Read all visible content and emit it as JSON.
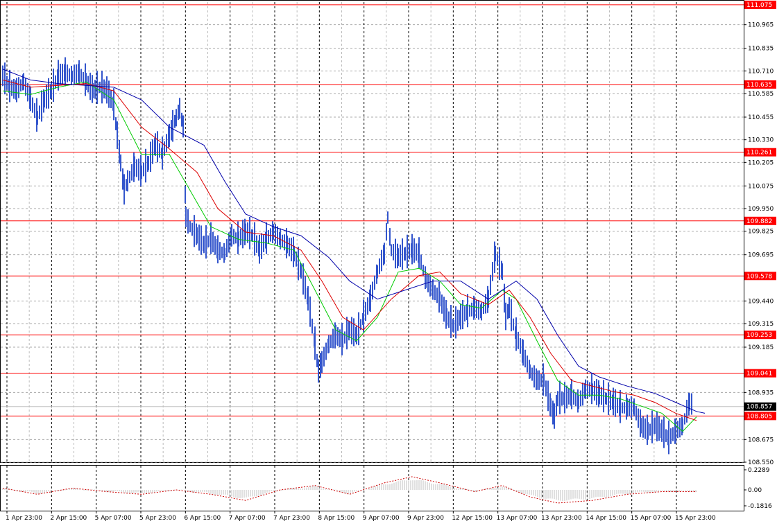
{
  "chart_data": {
    "type": "candlestick",
    "title": "",
    "xlabel": "",
    "ylabel": "",
    "ylim": [
      108.55,
      111.09
    ],
    "grid": true,
    "price_ticks": [
      "110.965",
      "110.835",
      "110.710",
      "110.585",
      "110.455",
      "110.330",
      "110.205",
      "110.075",
      "109.950",
      "109.825",
      "109.695",
      "109.440",
      "109.315",
      "109.185",
      "108.935",
      "108.675",
      "108.550"
    ],
    "x_labels": [
      "1 Apr 23:00",
      "2 Apr 15:00",
      "5 Apr 07:00",
      "5 Apr 23:00",
      "6 Apr 15:00",
      "7 Apr 07:00",
      "7 Apr 23:00",
      "8 Apr 15:00",
      "9 Apr 07:00",
      "9 Apr 23:00",
      "12 Apr 15:00",
      "13 Apr 07:00",
      "13 Apr 23:00",
      "14 Apr 15:00",
      "15 Apr 07:00",
      "15 Apr 23:00"
    ],
    "levels": [
      {
        "label": "111.075",
        "value": 111.075
      },
      {
        "label": "110.635",
        "value": 110.635
      },
      {
        "label": "110.261",
        "value": 110.261
      },
      {
        "label": "109.882",
        "value": 109.882
      },
      {
        "label": "109.578",
        "value": 109.578
      },
      {
        "label": "109.253",
        "value": 109.253
      },
      {
        "label": "109.041",
        "value": 109.041
      },
      {
        "label": "108.805",
        "value": 108.805
      }
    ],
    "current_price": {
      "label": "108.857",
      "value": 108.857
    },
    "path_points": [
      [
        0,
        110.68
      ],
      [
        10,
        110.62
      ],
      [
        20,
        110.6
      ],
      [
        30,
        110.65
      ],
      [
        40,
        110.55
      ],
      [
        50,
        110.45
      ],
      [
        60,
        110.55
      ],
      [
        70,
        110.6
      ],
      [
        80,
        110.68
      ],
      [
        90,
        110.7
      ],
      [
        100,
        110.68
      ],
      [
        110,
        110.7
      ],
      [
        120,
        110.65
      ],
      [
        130,
        110.6
      ],
      [
        140,
        110.62
      ],
      [
        150,
        110.6
      ],
      [
        160,
        110.52
      ],
      [
        165,
        110.35
      ],
      [
        170,
        110.2
      ],
      [
        175,
        110.05
      ],
      [
        180,
        110.1
      ],
      [
        190,
        110.18
      ],
      [
        200,
        110.15
      ],
      [
        210,
        110.2
      ],
      [
        220,
        110.3
      ],
      [
        230,
        110.25
      ],
      [
        240,
        110.35
      ],
      [
        245,
        110.4
      ],
      [
        250,
        110.45
      ],
      [
        255,
        110.5
      ],
      [
        260,
        110.4
      ],
      [
        264,
        109.9
      ],
      [
        270,
        109.85
      ],
      [
        280,
        109.8
      ],
      [
        290,
        109.75
      ],
      [
        300,
        109.78
      ],
      [
        310,
        109.72
      ],
      [
        320,
        109.7
      ],
      [
        330,
        109.8
      ],
      [
        340,
        109.78
      ],
      [
        350,
        109.82
      ],
      [
        360,
        109.8
      ],
      [
        370,
        109.72
      ],
      [
        380,
        109.78
      ],
      [
        390,
        109.82
      ],
      [
        400,
        109.78
      ],
      [
        410,
        109.75
      ],
      [
        420,
        109.7
      ],
      [
        430,
        109.6
      ],
      [
        440,
        109.45
      ],
      [
        450,
        109.2
      ],
      [
        455,
        109.05
      ],
      [
        460,
        109.1
      ],
      [
        470,
        109.2
      ],
      [
        480,
        109.25
      ],
      [
        490,
        109.22
      ],
      [
        500,
        109.28
      ],
      [
        510,
        109.25
      ],
      [
        520,
        109.35
      ],
      [
        530,
        109.45
      ],
      [
        540,
        109.6
      ],
      [
        550,
        109.7
      ],
      [
        555,
        109.9
      ],
      [
        560,
        109.72
      ],
      [
        570,
        109.68
      ],
      [
        580,
        109.7
      ],
      [
        590,
        109.72
      ],
      [
        600,
        109.7
      ],
      [
        610,
        109.55
      ],
      [
        620,
        109.5
      ],
      [
        630,
        109.45
      ],
      [
        640,
        109.35
      ],
      [
        650,
        109.3
      ],
      [
        660,
        109.35
      ],
      [
        670,
        109.38
      ],
      [
        680,
        109.4
      ],
      [
        690,
        109.38
      ],
      [
        700,
        109.45
      ],
      [
        710,
        109.7
      ],
      [
        720,
        109.6
      ],
      [
        725,
        109.35
      ],
      [
        730,
        109.4
      ],
      [
        740,
        109.25
      ],
      [
        750,
        109.15
      ],
      [
        760,
        109.05
      ],
      [
        770,
        109.0
      ],
      [
        780,
        109.0
      ],
      [
        790,
        108.85
      ],
      [
        795,
        108.8
      ],
      [
        800,
        108.9
      ],
      [
        810,
        108.9
      ],
      [
        820,
        108.92
      ],
      [
        830,
        108.88
      ],
      [
        840,
        108.95
      ],
      [
        850,
        108.95
      ],
      [
        860,
        108.92
      ],
      [
        870,
        108.9
      ],
      [
        880,
        108.88
      ],
      [
        890,
        108.85
      ],
      [
        900,
        108.85
      ],
      [
        910,
        108.85
      ],
      [
        920,
        108.75
      ],
      [
        930,
        108.72
      ],
      [
        940,
        108.75
      ],
      [
        950,
        108.72
      ],
      [
        960,
        108.68
      ],
      [
        970,
        108.72
      ],
      [
        980,
        108.75
      ],
      [
        990,
        108.88
      ],
      [
        995,
        108.86
      ]
    ],
    "ma_green": [
      [
        0,
        110.6
      ],
      [
        40,
        110.58
      ],
      [
        80,
        110.62
      ],
      [
        120,
        110.65
      ],
      [
        160,
        110.55
      ],
      [
        200,
        110.25
      ],
      [
        240,
        110.25
      ],
      [
        270,
        110.05
      ],
      [
        300,
        109.85
      ],
      [
        340,
        109.78
      ],
      [
        380,
        109.76
      ],
      [
        420,
        109.72
      ],
      [
        450,
        109.5
      ],
      [
        480,
        109.28
      ],
      [
        510,
        109.22
      ],
      [
        540,
        109.35
      ],
      [
        570,
        109.6
      ],
      [
        600,
        109.62
      ],
      [
        630,
        109.55
      ],
      [
        660,
        109.42
      ],
      [
        690,
        109.4
      ],
      [
        720,
        109.5
      ],
      [
        740,
        109.45
      ],
      [
        770,
        109.22
      ],
      [
        800,
        109.0
      ],
      [
        830,
        108.92
      ],
      [
        860,
        108.92
      ],
      [
        890,
        108.9
      ],
      [
        920,
        108.86
      ],
      [
        950,
        108.82
      ],
      [
        980,
        108.72
      ],
      [
        1000,
        108.8
      ]
    ],
    "ma_red": [
      [
        0,
        110.66
      ],
      [
        40,
        110.62
      ],
      [
        80,
        110.63
      ],
      [
        120,
        110.64
      ],
      [
        160,
        110.6
      ],
      [
        200,
        110.4
      ],
      [
        240,
        110.28
      ],
      [
        280,
        110.15
      ],
      [
        310,
        109.95
      ],
      [
        350,
        109.82
      ],
      [
        390,
        109.8
      ],
      [
        430,
        109.72
      ],
      [
        460,
        109.55
      ],
      [
        490,
        109.35
      ],
      [
        520,
        109.28
      ],
      [
        560,
        109.45
      ],
      [
        600,
        109.58
      ],
      [
        630,
        109.6
      ],
      [
        660,
        109.48
      ],
      [
        700,
        109.42
      ],
      [
        730,
        109.5
      ],
      [
        760,
        109.35
      ],
      [
        790,
        109.15
      ],
      [
        820,
        109.0
      ],
      [
        850,
        108.97
      ],
      [
        880,
        108.94
      ],
      [
        910,
        108.92
      ],
      [
        940,
        108.88
      ],
      [
        970,
        108.82
      ],
      [
        1000,
        108.78
      ]
    ],
    "ma_blue": [
      [
        0,
        110.72
      ],
      [
        40,
        110.66
      ],
      [
        80,
        110.64
      ],
      [
        120,
        110.63
      ],
      [
        160,
        110.62
      ],
      [
        200,
        110.55
      ],
      [
        240,
        110.4
      ],
      [
        290,
        110.3
      ],
      [
        320,
        110.1
      ],
      [
        350,
        109.92
      ],
      [
        390,
        109.85
      ],
      [
        430,
        109.8
      ],
      [
        470,
        109.68
      ],
      [
        500,
        109.55
      ],
      [
        540,
        109.45
      ],
      [
        580,
        109.5
      ],
      [
        620,
        109.55
      ],
      [
        660,
        109.55
      ],
      [
        700,
        109.45
      ],
      [
        740,
        109.55
      ],
      [
        770,
        109.45
      ],
      [
        800,
        109.25
      ],
      [
        830,
        109.08
      ],
      [
        860,
        109.02
      ],
      [
        900,
        108.97
      ],
      [
        940,
        108.93
      ],
      [
        970,
        108.88
      ],
      [
        1000,
        108.83
      ],
      [
        1012,
        108.82
      ]
    ],
    "oscillator": {
      "max_label": "0.2289",
      "zero_label": "0.00",
      "min_label": "-0.1816",
      "signal": [
        [
          0,
          0.02
        ],
        [
          50,
          -0.05
        ],
        [
          100,
          0.02
        ],
        [
          150,
          -0.02
        ],
        [
          200,
          -0.05
        ],
        [
          250,
          0.0
        ],
        [
          300,
          -0.05
        ],
        [
          350,
          -0.12
        ],
        [
          400,
          0.0
        ],
        [
          450,
          0.05
        ],
        [
          500,
          -0.05
        ],
        [
          550,
          0.08
        ],
        [
          590,
          0.15
        ],
        [
          630,
          0.08
        ],
        [
          680,
          -0.02
        ],
        [
          720,
          0.05
        ],
        [
          760,
          -0.08
        ],
        [
          800,
          -0.15
        ],
        [
          850,
          -0.12
        ],
        [
          900,
          -0.05
        ],
        [
          950,
          -0.02
        ],
        [
          1000,
          -0.02
        ]
      ]
    }
  }
}
